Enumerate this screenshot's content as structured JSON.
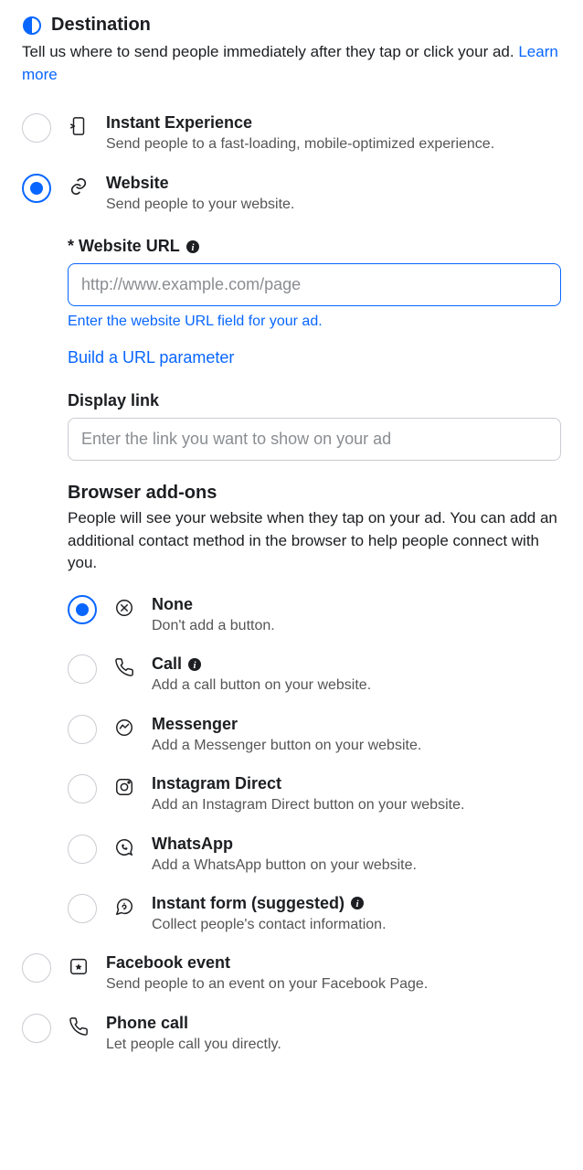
{
  "header": {
    "title": "Destination",
    "description": "Tell us where to send people immediately after they tap or click your ad. ",
    "learn_more": "Learn more"
  },
  "destinations": [
    {
      "key": "instant",
      "title": "Instant Experience",
      "sub": "Send people to a fast-loading, mobile-optimized experience."
    },
    {
      "key": "website",
      "title": "Website",
      "sub": "Send people to your website."
    },
    {
      "key": "fbevent",
      "title": "Facebook event",
      "sub": "Send people to an event on your Facebook Page."
    },
    {
      "key": "phone",
      "title": "Phone call",
      "sub": "Let people call you directly."
    }
  ],
  "website": {
    "url_label": "* Website URL",
    "url_placeholder": "http://www.example.com/page",
    "url_helper": "Enter the website URL field for your ad.",
    "build_param": "Build a URL parameter",
    "display_label": "Display link",
    "display_placeholder": "Enter the link you want to show on your ad",
    "addons_title": "Browser add-ons",
    "addons_desc": "People will see your website when they tap on your ad. You can add an additional contact method in the browser to help people connect with you.",
    "addons": [
      {
        "key": "none",
        "title": "None",
        "sub": "Don't add a button."
      },
      {
        "key": "call",
        "title": "Call",
        "sub": "Add a call button on your website.",
        "info": true
      },
      {
        "key": "messenger",
        "title": "Messenger",
        "sub": "Add a Messenger button on your website."
      },
      {
        "key": "igdirect",
        "title": "Instagram Direct",
        "sub": "Add an Instagram Direct button on your website."
      },
      {
        "key": "whatsapp",
        "title": "WhatsApp",
        "sub": "Add a WhatsApp button on your website."
      },
      {
        "key": "instantform",
        "title": "Instant form (suggested)",
        "sub": "Collect people's contact information.",
        "info": true
      }
    ]
  }
}
